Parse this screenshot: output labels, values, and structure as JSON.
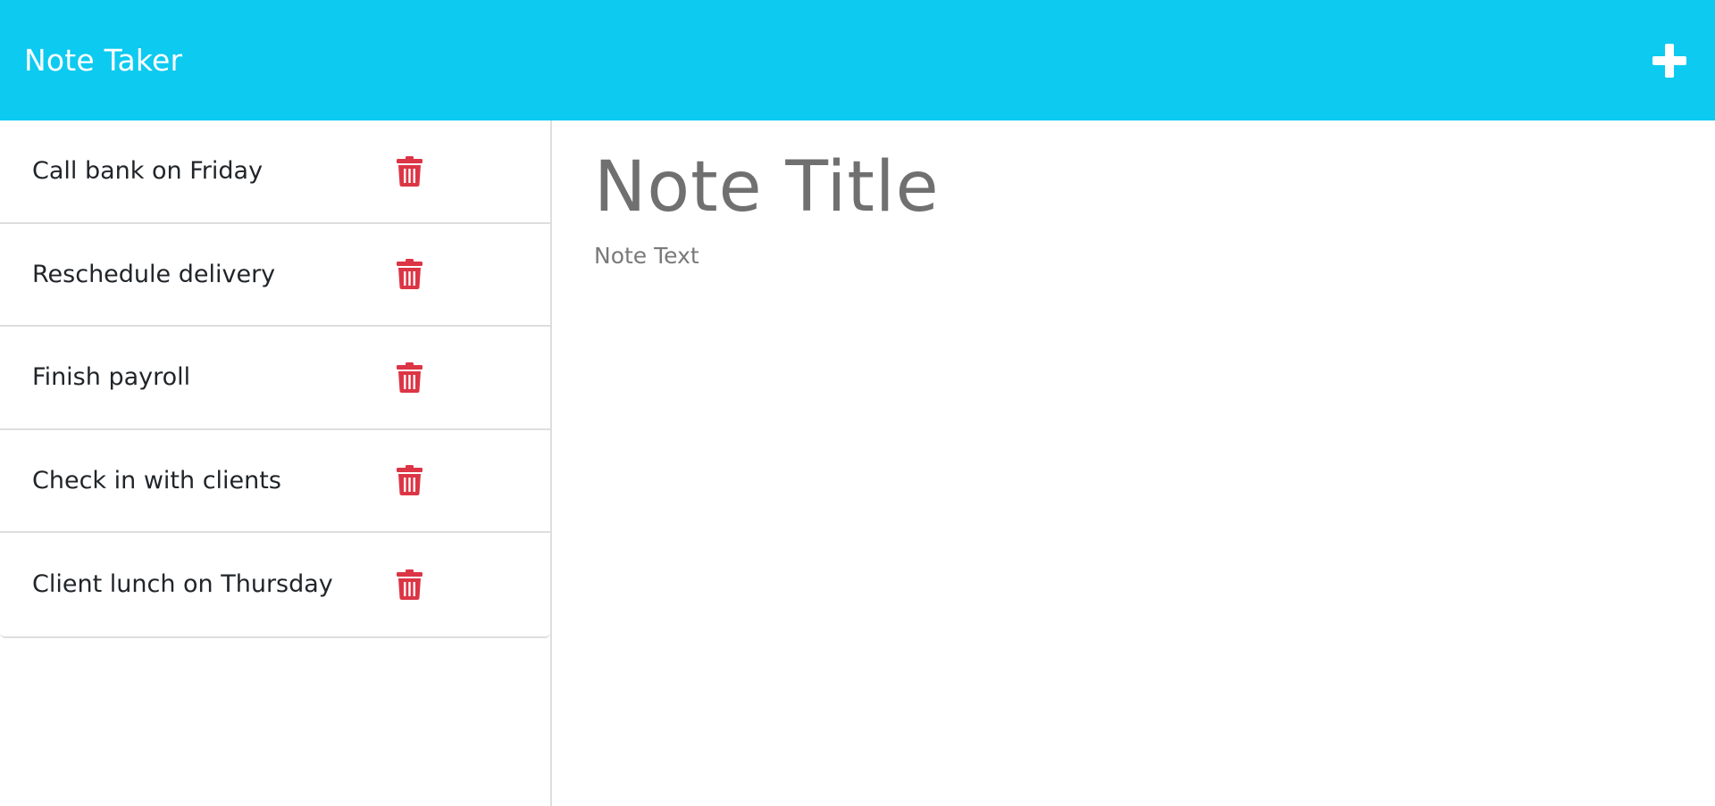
{
  "app": {
    "title": "Note Taker"
  },
  "colors": {
    "navbar_bg": "#0dcaf0",
    "delete_icon": "#dc3545",
    "divider": "#dedede"
  },
  "header": {
    "brand": "Note Taker",
    "add_icon": "plus-icon"
  },
  "notes": [
    {
      "title": "Call bank on Friday"
    },
    {
      "title": "Reschedule delivery"
    },
    {
      "title": "Finish payroll"
    },
    {
      "title": "Check in with clients"
    },
    {
      "title": "Client lunch on Thursday"
    }
  ],
  "editor": {
    "title_placeholder": "Note Title",
    "text_placeholder": "Note Text",
    "title_value": "",
    "text_value": ""
  }
}
